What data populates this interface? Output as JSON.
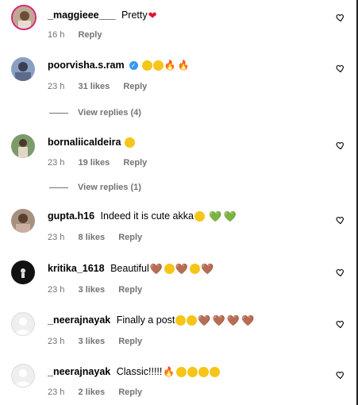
{
  "comments": [
    {
      "username": "_maggieee___",
      "text": "Pretty",
      "emojis": "❤",
      "time": "16 h",
      "likes": "",
      "reply": "Reply",
      "view_replies": ""
    },
    {
      "username": "poorvisha.s.ram",
      "text": "",
      "emojis": "😍😍🔥🔥",
      "time": "23 h",
      "likes": "31 likes",
      "reply": "Reply",
      "view_replies": "View replies (4)"
    },
    {
      "username": "bornaliicaldeira",
      "text": "",
      "emojis": "😍",
      "time": "23 h",
      "likes": "19 likes",
      "reply": "Reply",
      "view_replies": "View replies (1)"
    },
    {
      "username": "gupta.h16",
      "text": "Indeed it is cute akka",
      "emojis": "😍 💚💚",
      "time": "23 h",
      "likes": "8 likes",
      "reply": "Reply",
      "view_replies": ""
    },
    {
      "username": "kritika_1618",
      "text": "Beautiful",
      "emojis": "🤎😍🤎😍🤎",
      "time": "23 h",
      "likes": "3 likes",
      "reply": "Reply",
      "view_replies": ""
    },
    {
      "username": "_neerajnayak",
      "text": "Finally a post",
      "emojis": "😭😭🤎🤎🤎🤎",
      "time": "23 h",
      "likes": "3 likes",
      "reply": "Reply",
      "view_replies": ""
    },
    {
      "username": "_neerajnayak",
      "text": "Classic!!!!!",
      "emojis": "🔥😍😍😍😍",
      "time": "23 h",
      "likes": "2 likes",
      "reply": "Reply",
      "view_replies": ""
    }
  ],
  "icons": {
    "like": "heart-outline-icon",
    "verified": "verified-badge-icon"
  },
  "colors": {
    "meta": "#737373",
    "verified": "#3897f0"
  }
}
